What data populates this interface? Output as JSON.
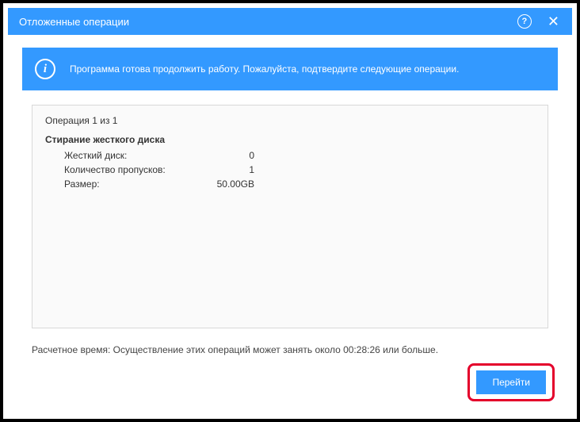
{
  "window": {
    "title": "Отложенные операции"
  },
  "banner": {
    "message": "Программа готова продолжить работу. Пожалуйста, подтвердите следующие операции."
  },
  "panel": {
    "counter": "Операция 1 из 1",
    "op_title": "Стирание жесткого диска",
    "rows": {
      "disk_label": "Жесткий диск:",
      "disk_value": "0",
      "passes_label": "Количество пропусков:",
      "passes_value": "1",
      "size_label": "Размер:",
      "size_value": "50.00GB"
    }
  },
  "estimate": {
    "text": "Расчетное время: Осуществление этих операций может занять около 00:28:26 или больше."
  },
  "buttons": {
    "proceed": "Перейти"
  },
  "icons": {
    "help": "?",
    "close": "✕",
    "info": "i"
  }
}
